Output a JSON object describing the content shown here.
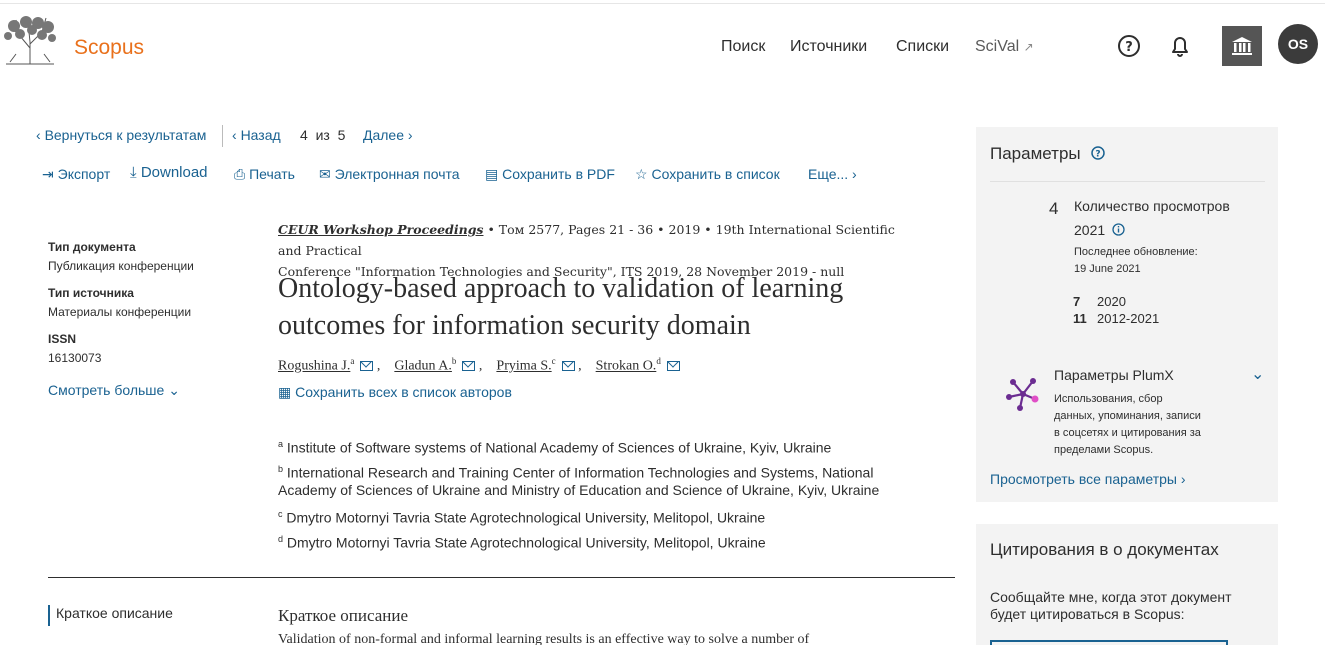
{
  "header": {
    "brand": "Scopus",
    "nav": [
      "Поиск",
      "Источники",
      "Списки",
      "SciVal"
    ],
    "scival_arrow": "↗",
    "avatar_initials": "OS",
    "icons": [
      "help-icon",
      "bell-icon",
      "institution-icon"
    ]
  },
  "result_nav": {
    "back_results": "Вернуться к результатам",
    "back": "Назад",
    "position": "4",
    "of": "из",
    "total": "5",
    "next": "Далее"
  },
  "toolbar": {
    "export": "Экспорт",
    "download": "Download",
    "print": "Печать",
    "email": "Электронная почта",
    "save_pdf": "Сохранить в PDF",
    "save_list": "Сохранить в список",
    "more": "Еще..."
  },
  "doc_meta": {
    "doc_type_label": "Тип документа",
    "doc_type": "Публикация конференции",
    "source_type_label": "Тип источника",
    "source_type": "Материалы конференции",
    "issn_label": "ISSN",
    "issn": "16130073",
    "see_more": "Смотреть больше"
  },
  "source": {
    "journal": "CEUR Workshop Proceedings",
    "details_line1": " • Том 2577, Pages 21 - 36 • 2019 • 19th International Scientific and Practical",
    "details_line2": "Conference \"Information Technologies and Security\", ITS 2019, 28 November 2019 - null"
  },
  "article": {
    "title_line1": "Ontology-based approach to validation of learning",
    "title_line2": "outcomes for information security domain",
    "authors": [
      {
        "name": "Rogushina J.",
        "sup": "a"
      },
      {
        "name": "Gladun A.",
        "sup": "b"
      },
      {
        "name": "Pryima S.",
        "sup": "c"
      },
      {
        "name": "Strokan O.",
        "sup": "d"
      }
    ],
    "save_all_authors": "Сохранить всех в список авторов",
    "affiliations": [
      {
        "sup": "a",
        "text": "Institute of Software systems of National Academy of Sciences of Ukraine, Kyiv, Ukraine"
      },
      {
        "sup": "b",
        "text": "International Research and Training Center of Information Technologies and Systems, National"
      },
      {
        "sup": "",
        "text": "Academy of Sciences of Ukraine and Ministry of Education and Science of Ukraine, Kyiv, Ukraine"
      },
      {
        "sup": "c",
        "text": "Dmytro Motornyi Tavria State Agrotechnological University, Melitopol, Ukraine"
      },
      {
        "sup": "d",
        "text": "Dmytro Motornyi Tavria State Agrotechnological University, Melitopol, Ukraine"
      }
    ],
    "abstract_nav": "Краткое описание",
    "abstract_heading": "Краткое описание",
    "abstract_start": "Validation of non-formal and informal learning results is an effective way to solve a number of"
  },
  "metrics": {
    "title": "Параметры",
    "views_count": "4",
    "views_label": "Количество просмотров",
    "views_year": "2021",
    "updated_label": "Последнее обновление:",
    "updated_date": "19 June 2021",
    "row1_num": "7",
    "row1_year": "2020",
    "row2_num": "11",
    "row2_year": "2012-2021",
    "plumx_title": "Параметры PlumX",
    "plumx_desc": [
      "Использования, сбор",
      "данных, упоминания, записи",
      "в соцсетях и цитирования за",
      "пределами Scopus."
    ],
    "view_all": "Просмотреть все параметры"
  },
  "citations": {
    "title": "Цитирования в о документах",
    "notify_line1": "Сообщайте мне, когда этот документ",
    "notify_line2": "будет цитироваться в Scopus:"
  },
  "colors": {
    "brand": "#e9711c",
    "link": "#1a6291",
    "panel": "#f3f3f3",
    "plumx": "#6b2c91"
  }
}
